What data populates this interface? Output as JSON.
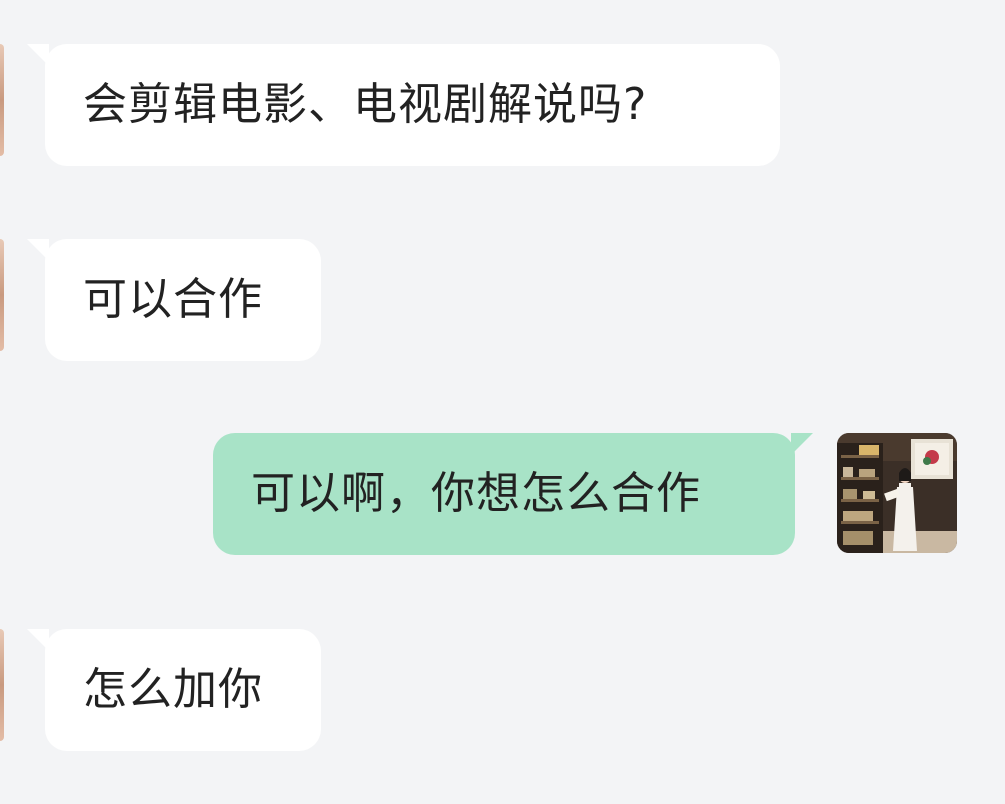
{
  "messages": [
    {
      "sender": "other",
      "text": "会剪辑电影、电视剧解说吗?"
    },
    {
      "sender": "other",
      "text": "可以合作"
    },
    {
      "sender": "me",
      "text": "可以啊，你想怎么合作"
    },
    {
      "sender": "other",
      "text": "怎么加你"
    }
  ],
  "colors": {
    "background": "#f3f4f6",
    "incoming_bubble": "#ffffff",
    "outgoing_bubble": "#a8e3c7",
    "text": "#222222"
  }
}
